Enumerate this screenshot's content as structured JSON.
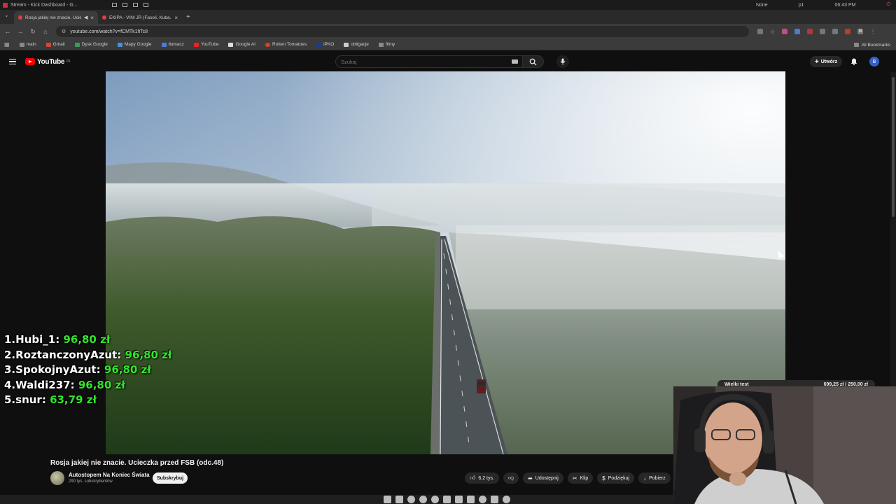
{
  "os_bar": {
    "app_title": "Stream - Kick Dashboard - G...",
    "profile": "None",
    "workspace": "p1",
    "clock": "06:43 PM"
  },
  "tabs": [
    {
      "label": "Rosja jakiej nie znacie. Ucieczka przed FSB",
      "active": true
    },
    {
      "label": "EKIPA - VINI JR (Fasoli, Kuba...",
      "active": false
    }
  ],
  "address_bar": {
    "url": "youtube.com/watch?v=fCMTk1fiTc8"
  },
  "bookmarks": [
    "main",
    "Gmail",
    "Dysk Google",
    "Mapy Google",
    "tłumacz",
    "YouTube",
    "Google AI",
    "Rotten Tomatoes",
    "iPKO",
    "obligacje",
    "filmy"
  ],
  "bookmarks_all": "All Bookmarks",
  "youtube": {
    "logo": "YouTube",
    "region": "PL",
    "search_placeholder": "Szukaj",
    "create_label": "Utwórz",
    "account_initial": "B"
  },
  "leaderboard": [
    {
      "rank": "1.",
      "name": "Hubi_1:",
      "amount": "96,80 zł"
    },
    {
      "rank": "2.",
      "name": "RoztanczonyAzut:",
      "amount": "96,80 zł"
    },
    {
      "rank": "3.",
      "name": "SpokojnyAzut:",
      "amount": "96,80 zł"
    },
    {
      "rank": "4.",
      "name": "Waldi237:",
      "amount": "96,80 zł"
    },
    {
      "rank": "5.",
      "name": "snur:",
      "amount": "63,79 zł"
    }
  ],
  "video": {
    "title": "Rosja jakiej nie znacie. Ucieczka przed FSB (odc.48)",
    "channel": "Autostopem Na Koniec Świata",
    "subscribers": "290 tys. subskrybentów",
    "subscribe_label": "Subskrybuj",
    "likes": "6,2 tys.",
    "share_label": "Udostępnij",
    "clip_label": "Klip",
    "thanks_label": "Podziękuj",
    "download_label": "Pobierz"
  },
  "goal_widget": {
    "label": "Wielki test",
    "progress": "699,25 zł / 250,00 zł"
  },
  "icons": [
    "menu-icon",
    "search-icon",
    "mic-icon",
    "bell-icon",
    "like-icon",
    "dislike-icon",
    "share-icon",
    "scissors-icon",
    "thanks-icon",
    "download-icon"
  ],
  "colors": {
    "youtube_red": "#ff0000",
    "leaderboard_amount": "#34e52c",
    "background": "#0f0f0f"
  }
}
